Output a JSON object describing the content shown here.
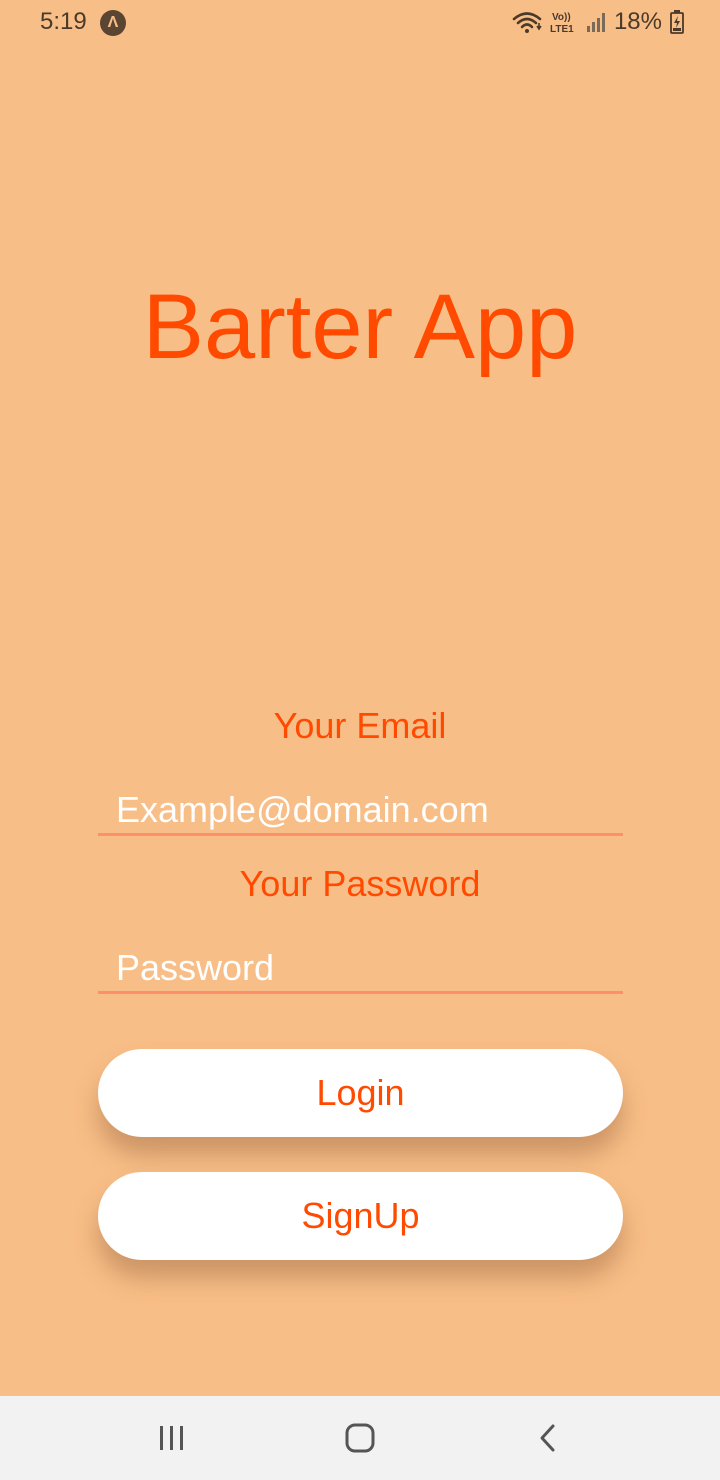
{
  "status_bar": {
    "time": "5:19",
    "expo_glyph": "Λ",
    "network_top": "Vo))",
    "network_bottom": "LTE1",
    "battery": "18%",
    "icons": [
      "expo-icon",
      "wifi-icon",
      "signal-icon",
      "battery-charging-icon"
    ]
  },
  "app": {
    "title": "Barter App"
  },
  "form": {
    "email_label": "Your Email",
    "email_placeholder": "Example@domain.com",
    "password_label": "Your Password",
    "password_placeholder": "Password",
    "login_label": "Login",
    "signup_label": "SignUp"
  },
  "nav_bar": {
    "icons": [
      "recents-icon",
      "home-icon",
      "back-icon"
    ]
  },
  "colors": {
    "background": "#f8be87",
    "accent": "#ff4a00",
    "input_underline": "#ff8f6b",
    "button_bg": "#ffffff",
    "nav_bg": "#f2f2f2"
  }
}
